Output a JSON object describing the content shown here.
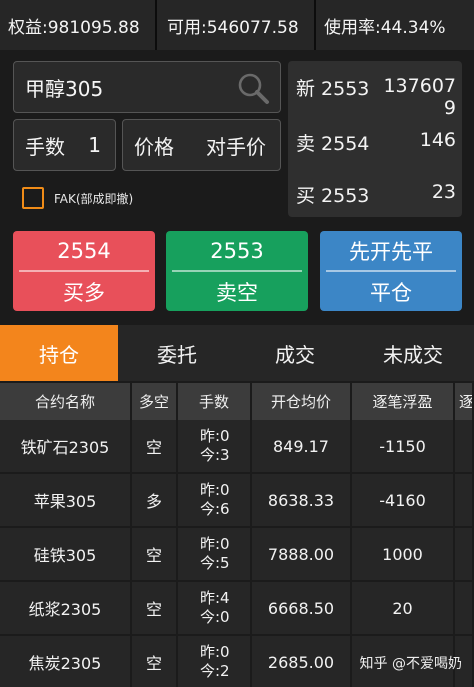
{
  "account": {
    "equity": "权益:981095.88",
    "available": "可用:546077.58",
    "usage": "使用率:44.34%"
  },
  "order": {
    "contract": "甲醇305",
    "quantity_label": "手数",
    "quantity_value": "1",
    "price_label": "价格",
    "price_value": "对手价",
    "fak_label": "FAK(部成即撤)"
  },
  "quote": {
    "last_label": "新 2553",
    "last_volume": [
      "137607",
      "9"
    ],
    "ask_label": "卖 2554",
    "ask_volume": "146",
    "bid_label": "买 2553",
    "bid_volume": "23"
  },
  "actions": {
    "buy_price": "2554",
    "buy_label": "买多",
    "sell_price": "2553",
    "sell_label": "卖空",
    "close_top": "先开先平",
    "close_label": "平仓"
  },
  "tabs": [
    {
      "label": "持仓",
      "active": true
    },
    {
      "label": "委托",
      "active": false
    },
    {
      "label": "成交",
      "active": false
    },
    {
      "label": "未成交",
      "active": false
    }
  ],
  "table": {
    "headers": [
      "合约名称",
      "多空",
      "手数",
      "开仓均价",
      "逐笔浮盈",
      "逐"
    ],
    "rows": [
      {
        "name": "铁矿石2305",
        "dir": "空",
        "dir_type": "short",
        "yesterday": "昨:0",
        "today": "今:3",
        "avg_price": "849.17",
        "pnl": "-1150",
        "pnl_sign": "neg"
      },
      {
        "name": "苹果305",
        "dir": "多",
        "dir_type": "long",
        "yesterday": "昨:0",
        "today": "今:6",
        "avg_price": "8638.33",
        "pnl": "-4160",
        "pnl_sign": "neg"
      },
      {
        "name": "硅铁305",
        "dir": "空",
        "dir_type": "short",
        "yesterday": "昨:0",
        "today": "今:5",
        "avg_price": "7888.00",
        "pnl": "1000",
        "pnl_sign": "pos"
      },
      {
        "name": "纸浆2305",
        "dir": "空",
        "dir_type": "short",
        "yesterday": "昨:4",
        "today": "今:0",
        "avg_price": "6668.50",
        "pnl": "20",
        "pnl_sign": "pos"
      },
      {
        "name": "焦炭2305",
        "dir": "空",
        "dir_type": "short",
        "yesterday": "昨:0",
        "today": "今:2",
        "avg_price": "2685.00",
        "pnl": "",
        "pnl_sign": "neg"
      }
    ]
  },
  "watermark": "知乎 @不爱喝奶",
  "colors": {
    "accent_orange": "#f3851c",
    "buy_red": "#e8505a",
    "sell_green": "#17a05d",
    "close_blue": "#3c86c6"
  }
}
